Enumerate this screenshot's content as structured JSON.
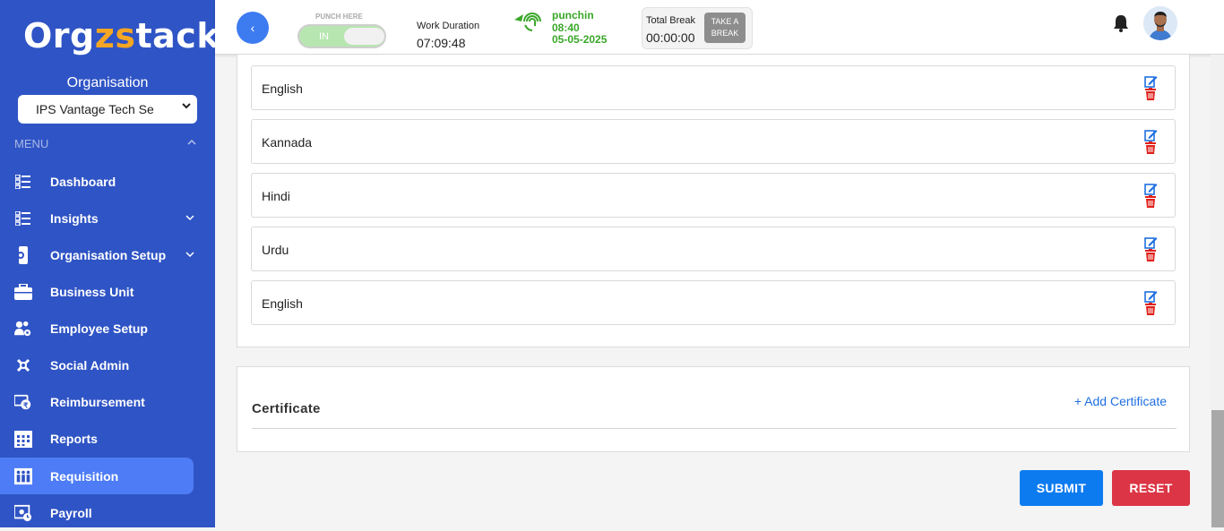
{
  "brand": {
    "logo_a": "Org",
    "logo_b": "zs",
    "logo_c": "tack"
  },
  "sidebar": {
    "org_label": "Organisation",
    "org_selected": "IPS Vantage Tech Se",
    "menu_label": "MENU",
    "items": [
      {
        "label": "Dashboard",
        "icon": "dashboard-icon"
      },
      {
        "label": "Insights",
        "icon": "list-icon"
      },
      {
        "label": "Organisation Setup",
        "icon": "org-setup-icon"
      },
      {
        "label": "Business Unit",
        "icon": "briefcase-icon"
      },
      {
        "label": "Employee Setup",
        "icon": "users-gear-icon"
      },
      {
        "label": "Social Admin",
        "icon": "social-icon"
      },
      {
        "label": "Reimbursement",
        "icon": "reimbursement-icon"
      },
      {
        "label": "Reports",
        "icon": "calendar-grid-icon"
      },
      {
        "label": "Requisition",
        "icon": "people-icon"
      },
      {
        "label": "Payroll",
        "icon": "payroll-icon"
      }
    ]
  },
  "topbar": {
    "back_glyph": "‹",
    "punch_label": "PUNCH HERE",
    "punch_state": "IN",
    "work_label": "Work Duration",
    "work_value": "07:09:48",
    "punchin_label": "punchin",
    "punchin_time": "08:40",
    "punchin_date": "05-05-2025",
    "break_label": "Total Break",
    "break_value": "00:00:00",
    "take_break_1": "TAKE A",
    "take_break_2": "BREAK"
  },
  "languages": [
    "English",
    "Kannada",
    "Hindi",
    "Urdu",
    "English"
  ],
  "certificate": {
    "title": "Certificate",
    "add_label": "+ Add Certificate"
  },
  "actions": {
    "submit": "SUBMIT",
    "reset": "RESET"
  },
  "colors": {
    "sidebar": "#2f54c5",
    "active": "#4d7cf6",
    "submit": "#0d7bf0",
    "reset": "#dc3545",
    "punch": "#3aa729"
  }
}
